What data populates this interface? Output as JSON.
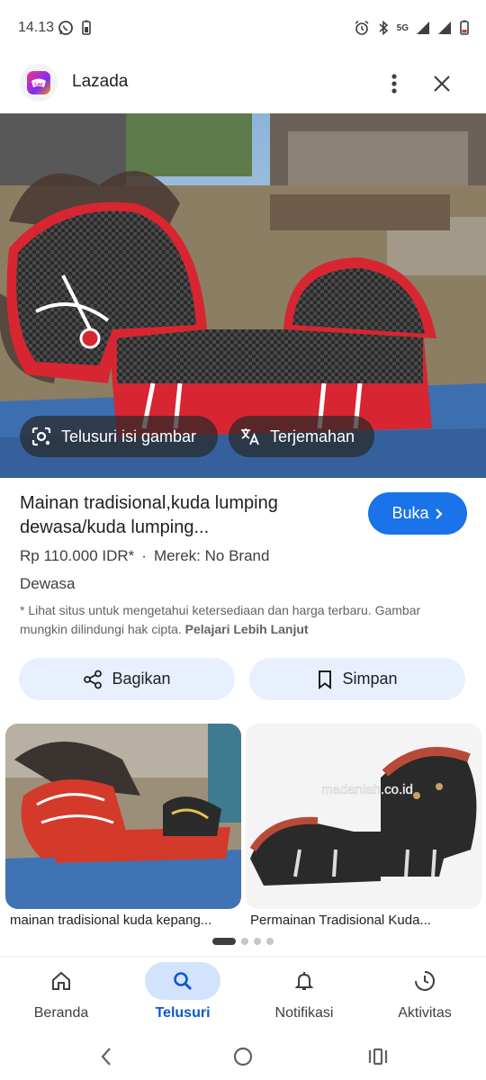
{
  "status_bar": {
    "time": "14.13",
    "network": "5G"
  },
  "header": {
    "title": "Lazada",
    "logo_text": "Laz"
  },
  "hero": {
    "lens_label": "Telusuri isi gambar",
    "translate_label": "Terjemahan"
  },
  "product": {
    "title": "Mainan tradisional,kuda lumping dewasa/kuda lumping...",
    "visit_label": "Buka",
    "price": "Rp 110.000 IDR*",
    "separator": "·",
    "brand": "Merek: No Brand",
    "category": "Dewasa",
    "disclaimer": "* Lihat situs untuk mengetahui ketersediaan dan harga terbaru. Gambar mungkin dilindungi hak cipta.",
    "disclaimer_link": "Pelajari Lebih Lanjut"
  },
  "actions": {
    "share_label": "Bagikan",
    "save_label": "Simpan"
  },
  "related": [
    {
      "caption": "mainan tradisional kuda kepang..."
    },
    {
      "caption": "Permainan Tradisional Kuda...",
      "watermark": "madaniah.co.id"
    }
  ],
  "bottom_nav": [
    {
      "label": "Beranda",
      "icon": "home-icon",
      "active": false
    },
    {
      "label": "Telusuri",
      "icon": "search-icon",
      "active": true
    },
    {
      "label": "Notifikasi",
      "icon": "bell-icon",
      "active": false
    },
    {
      "label": "Aktivitas",
      "icon": "activity-icon",
      "active": false
    }
  ],
  "colors": {
    "accent": "#1a73e8",
    "active_nav_bg": "#d3e3fd",
    "action_bg": "#e8f0fe"
  }
}
